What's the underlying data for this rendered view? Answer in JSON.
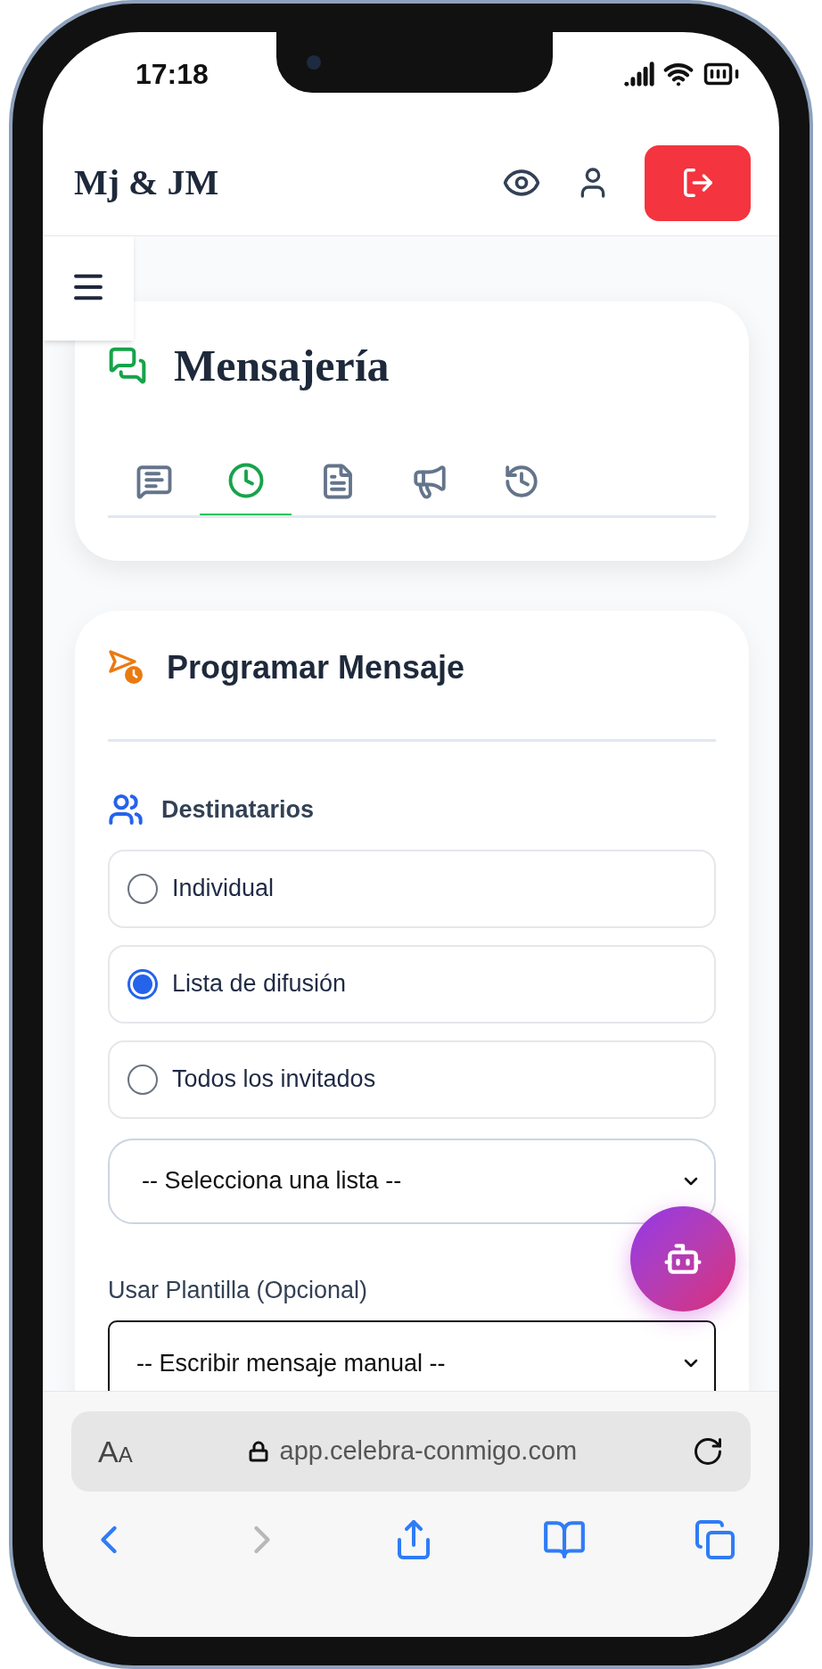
{
  "status_bar": {
    "time": "17:18"
  },
  "header": {
    "logo": "Mj & JM"
  },
  "messaging": {
    "title": "Mensajería",
    "tabs": [
      {
        "kind": "chat",
        "selected": false
      },
      {
        "kind": "schedule",
        "selected": true
      },
      {
        "kind": "template",
        "selected": false
      },
      {
        "kind": "broadcast",
        "selected": false
      },
      {
        "kind": "history",
        "selected": false
      }
    ]
  },
  "schedule_form": {
    "title": "Programar Mensaje",
    "recipients_label": "Destinatarios",
    "options": [
      {
        "label": "Individual",
        "selected": false
      },
      {
        "label": "Lista de difusión",
        "selected": true
      },
      {
        "label": "Todos los invitados",
        "selected": false
      }
    ],
    "list_select": {
      "value": "-- Selecciona una lista --"
    },
    "template_label": "Usar Plantilla (Opcional)",
    "template_select": {
      "value": "-- Escribir mensaje manual --"
    }
  },
  "browser": {
    "text_size": "AA",
    "url": "app.celebra-conmigo.com"
  }
}
